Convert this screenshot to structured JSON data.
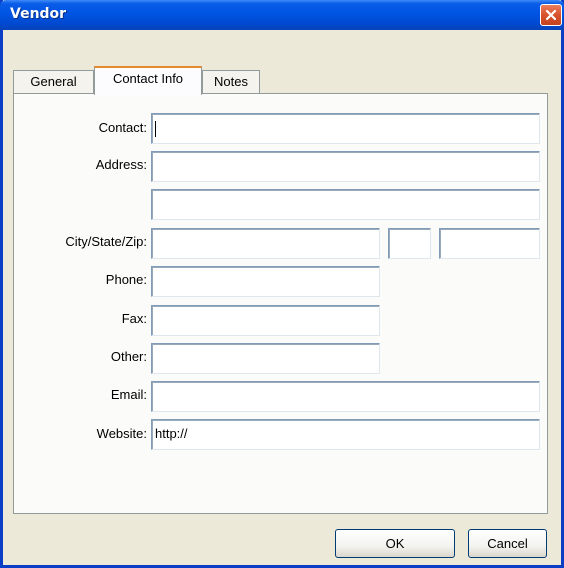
{
  "window": {
    "title": "Vendor"
  },
  "tabs": [
    {
      "label": "General"
    },
    {
      "label": "Contact Info"
    },
    {
      "label": "Notes"
    }
  ],
  "form": {
    "contact": {
      "label": "Contact:",
      "value": ""
    },
    "address": {
      "label": "Address:",
      "value": "",
      "value2": ""
    },
    "city_state_zip": {
      "label": "City/State/Zip:",
      "city": "",
      "state": "",
      "zip": ""
    },
    "phone": {
      "label": "Phone:",
      "value": ""
    },
    "fax": {
      "label": "Fax:",
      "value": ""
    },
    "other": {
      "label": "Other:",
      "value": ""
    },
    "email": {
      "label": "Email:",
      "value": ""
    },
    "website": {
      "label": "Website:",
      "value": "http://"
    }
  },
  "buttons": {
    "ok": "OK",
    "cancel": "Cancel"
  },
  "colors": {
    "title_bar": "#0054e3",
    "close_button": "#d9512d",
    "active_tab_accent": "#e68b2c"
  }
}
